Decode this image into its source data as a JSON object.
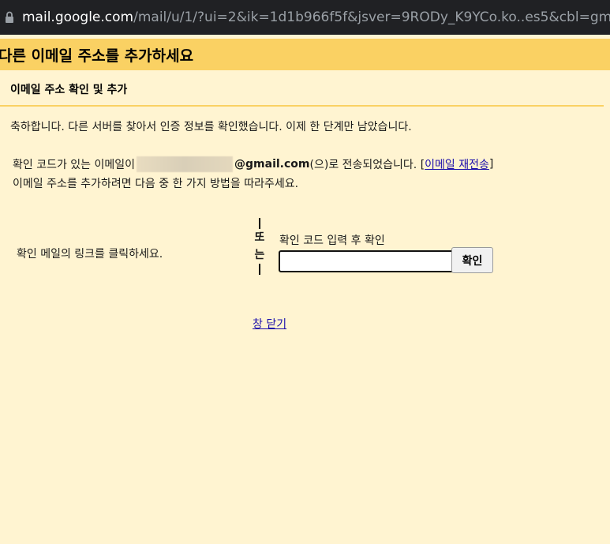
{
  "browser": {
    "url_host": "mail.google.com",
    "url_path": "/mail/u/1/?ui=2&ik=1d1b966f5f&jsver=9RODy_K9YCo.ko..es5&cbl=gmail...."
  },
  "page": {
    "title": "다른 이메일 주소를 추가하세요",
    "section_title": "이메일 주소 확인 및 추가",
    "congrats": "축하합니다. 다른 서버를 찾아서 인증 정보를 확인했습니다. 이제 한 단계만 남았습니다.",
    "sent_prefix": "확인 코드가 있는 이메일이",
    "email_domain": "@gmail.com",
    "sent_suffix": "(으)로 전송되었습니다. [",
    "resend_link": "이메일 재전송",
    "bracket_close": "]",
    "instructions": "이메일 주소를 추가하려면 다음 중 한 가지 방법을 따라주세요.",
    "click_link_option": "확인 메일의 링크를 클릭하세요.",
    "or_top": "또",
    "or_bottom": "는",
    "code_label": "확인 코드 입력 후 확인",
    "code_value": "",
    "confirm_button": "확인",
    "close_window": "창 닫기"
  },
  "colors": {
    "background": "#fff4d1",
    "header_bar": "#fad163",
    "link": "#1a0dab",
    "url_bar": "#202124"
  }
}
